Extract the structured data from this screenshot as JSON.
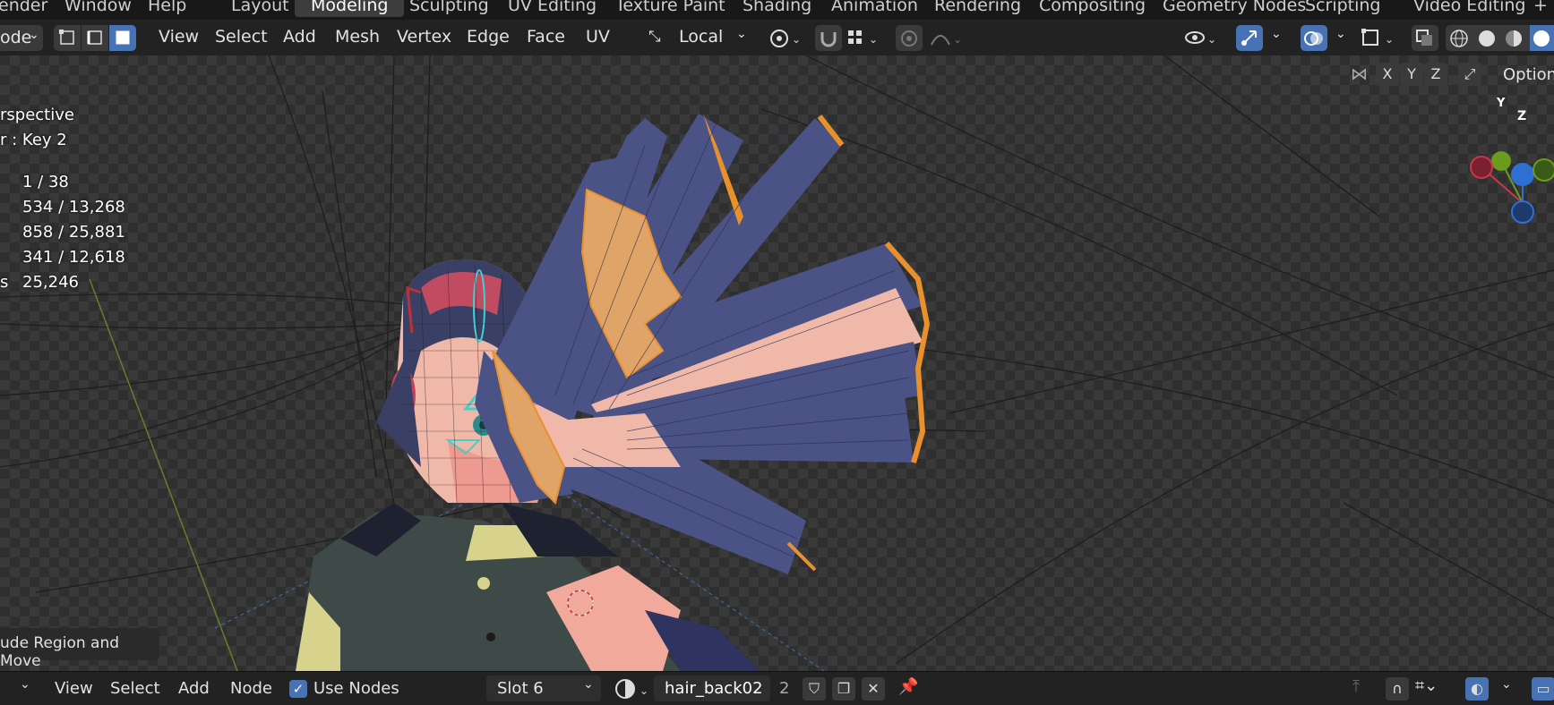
{
  "topbar": {
    "menus": [
      "ender",
      "Window",
      "Help"
    ],
    "workspaces": [
      "Layout",
      "Modeling",
      "Sculpting",
      "UV Editing",
      "Texture Paint",
      "Shading",
      "Animation",
      "Rendering",
      "Compositing",
      "Geometry Nodes",
      "Scripting",
      "Video Editing"
    ],
    "active_workspace": "Modeling",
    "add_tab": "+"
  },
  "header": {
    "mode": "ode",
    "menus": [
      "View",
      "Select",
      "Add",
      "Mesh",
      "Vertex",
      "Edge",
      "Face",
      "UV"
    ],
    "transform_orientation": "Local",
    "mirror_axes": [
      "X",
      "Y",
      "Z"
    ],
    "options_label": "Option"
  },
  "viewport": {
    "view_name": "rspective",
    "shape_key": "r : Key 2",
    "stats": [
      {
        "label": "",
        "value": "1 / 38"
      },
      {
        "label": "",
        "value": "534 / 13,268"
      },
      {
        "label": "",
        "value": "858 / 25,881"
      },
      {
        "label": "",
        "value": "341 / 12,618"
      },
      {
        "label": "s",
        "value": "25,246"
      }
    ],
    "last_operator": "ude Region and Move",
    "gizmo": {
      "z": "Z",
      "y": "Y"
    }
  },
  "bottombar": {
    "menus": [
      "View",
      "Select",
      "Add",
      "Node"
    ],
    "use_nodes_label": "Use Nodes",
    "use_nodes_checked": true,
    "slot": "Slot 6",
    "material_name": "hair_back02",
    "users": "2"
  },
  "colors": {
    "accent_blue": "#4772b3",
    "hair_blue": "#4a5286",
    "hair_pink": "#f0b8a8",
    "selection_orange": "#e8902c",
    "gizmo_z": "#2f6fd1",
    "gizmo_y": "#6a9a1e",
    "gizmo_x": "#c8384a"
  }
}
